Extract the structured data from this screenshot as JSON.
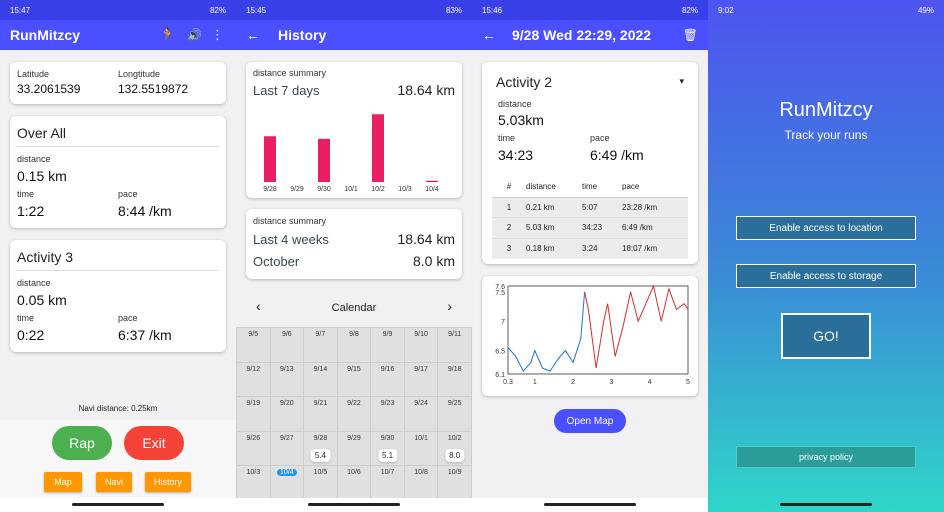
{
  "s1": {
    "status_time": "15:47",
    "status_batt": "82%",
    "title": "RunMitzcy",
    "lat_label": "Latitude",
    "lat": "33.2061539",
    "lng_label": "Longtitude",
    "lng": "132.5519872",
    "overall": {
      "title": "Over All",
      "distance_label": "distance",
      "distance": "0.15 km",
      "time_label": "time",
      "time": "1:22",
      "pace_label": "pace",
      "pace": "8:44 /km"
    },
    "activity": {
      "title": "Activity 3",
      "distance_label": "distance",
      "distance": "0.05 km",
      "time_label": "time",
      "time": "0:22",
      "pace_label": "pace",
      "pace": "6:37 /km"
    },
    "navi_distance": "Navi distance: 0.25km",
    "rap": "Rap",
    "exit": "Exit",
    "map": "Map",
    "navi": "Navi",
    "history": "History"
  },
  "s2": {
    "status_time": "15:45",
    "status_batt": "83%",
    "title": "History",
    "sum1": {
      "label": "distance summary",
      "period": "Last 7 days",
      "total": "18.64 km"
    },
    "bars": {
      "categories": [
        "9/28",
        "9/29",
        "9/30",
        "10/1",
        "10/2",
        "10/3",
        "10/4"
      ],
      "values": [
        5.4,
        0,
        5.1,
        0,
        8.0,
        0,
        0.15
      ]
    },
    "sum2": {
      "label": "distance summary",
      "period": "Last 4 weeks",
      "total": "18.64 km",
      "month": "October",
      "month_total": "8.0 km"
    },
    "calendar_title": "Calendar",
    "weeks": [
      [
        "9/5",
        "9/6",
        "9/7",
        "9/8",
        "9/9",
        "9/10",
        "9/11"
      ],
      [
        "9/12",
        "9/13",
        "9/14",
        "9/15",
        "9/16",
        "9/17",
        "9/18"
      ],
      [
        "9/19",
        "9/20",
        "9/21",
        "9/22",
        "9/23",
        "9/24",
        "9/25"
      ],
      [
        "9/26",
        "9/27",
        "9/28",
        "9/29",
        "9/30",
        "10/1",
        "10/2"
      ],
      [
        "10/3",
        "10/4",
        "10/5",
        "10/6",
        "10/7",
        "10/8",
        "10/9"
      ]
    ],
    "chips": {
      "9/28": "5.4",
      "9/30": "5.1",
      "10/2": "8.0"
    },
    "today": "10/4"
  },
  "s3": {
    "status_time": "15:46",
    "status_batt": "82%",
    "title": "9/28 Wed 22:29, 2022",
    "activity": "Activity 2",
    "distance_label": "distance",
    "distance": "5.03km",
    "time_label": "time",
    "time": "34:23",
    "pace_label": "pace",
    "pace": "6:49 /km",
    "headers": [
      "#",
      "distance",
      "time",
      "pace"
    ],
    "rows": [
      [
        "1",
        "0.21 km",
        "5:07",
        "23:28 /km"
      ],
      [
        "2",
        "5.03 km",
        "34:23",
        "6:49 /km"
      ],
      [
        "3",
        "0.18 km",
        "3:24",
        "18:07 /km"
      ]
    ],
    "open_map": "Open Map",
    "chart_data": {
      "type": "line",
      "x": [
        0.3,
        0.5,
        0.7,
        0.9,
        1.0,
        1.2,
        1.4,
        1.6,
        1.8,
        2.0,
        2.2,
        2.3,
        2.4,
        2.6,
        2.8,
        2.9,
        3.1,
        3.3,
        3.5,
        3.7,
        3.9,
        4.1,
        4.3,
        4.5,
        4.7,
        4.9,
        5.0
      ],
      "y": [
        6.55,
        6.4,
        6.15,
        6.3,
        6.5,
        6.2,
        6.15,
        6.35,
        6.5,
        6.3,
        6.7,
        7.5,
        7.2,
        6.2,
        7.0,
        7.3,
        6.4,
        6.9,
        7.5,
        7.0,
        7.3,
        7.6,
        7.0,
        7.55,
        7.2,
        7.3,
        7.2
      ],
      "xticks": [
        "0.3",
        "1",
        "2",
        "3",
        "4",
        "5"
      ],
      "yticks": [
        "7.6",
        "7.5",
        "7",
        "6.5",
        "6.1"
      ],
      "xlim": [
        0.3,
        5
      ],
      "ylim": [
        6.1,
        7.6
      ],
      "series_colors": [
        "#1976d2",
        "#d32f2f"
      ]
    }
  },
  "s4": {
    "status_time": "9:02",
    "status_batt": "49%",
    "app": "RunMitzcy",
    "tagline": "Track your runs",
    "loc": "Enable access to location",
    "storage": "Enable access to storage",
    "go": "GO!",
    "privacy": "privacy policy"
  }
}
